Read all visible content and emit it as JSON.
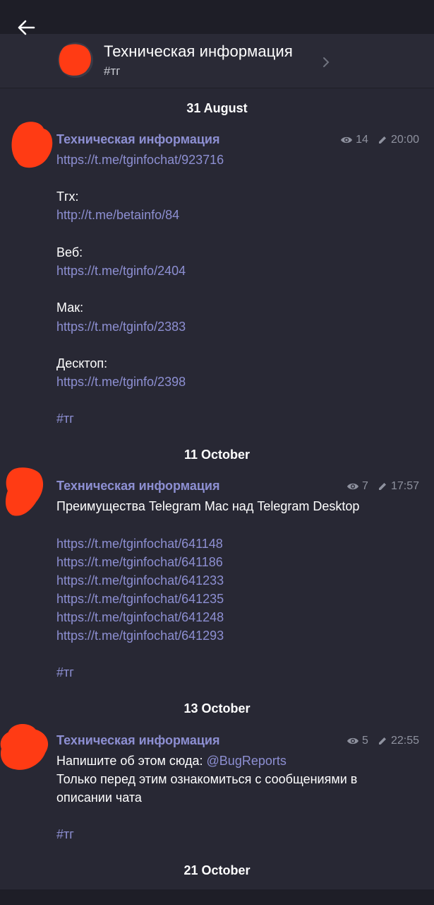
{
  "header": {
    "title": "Техническая информация",
    "subtitle": "#тг"
  },
  "dates": [
    "31 August",
    "11 October",
    "13 October",
    "21 October"
  ],
  "messages": [
    {
      "author": "Техническая информация",
      "views": "14",
      "time": "20:00",
      "lines": [
        {
          "text": "https://t.me/tginfochat/923716",
          "kind": "link"
        },
        {
          "text": "Тгх:",
          "kind": "text"
        },
        {
          "text": "http://t.me/betainfo/84",
          "kind": "link"
        },
        {
          "text": "Веб:",
          "kind": "text"
        },
        {
          "text": "https://t.me/tginfo/2404",
          "kind": "link"
        },
        {
          "text": "Мак:",
          "kind": "text"
        },
        {
          "text": "https://t.me/tginfo/2383",
          "kind": "link"
        },
        {
          "text": "Десктоп:",
          "kind": "text"
        },
        {
          "text": "https://t.me/tginfo/2398",
          "kind": "link"
        },
        {
          "text": "#тг",
          "kind": "hashtag"
        }
      ]
    },
    {
      "author": "Техническая информация",
      "views": "7",
      "time": "17:57",
      "lines": [
        {
          "text": "Преимущества Telegram Mac над Telegram Desktop",
          "kind": "text"
        },
        {
          "text": "https://t.me/tginfochat/641148",
          "kind": "link"
        },
        {
          "text": "https://t.me/tginfochat/641186",
          "kind": "link"
        },
        {
          "text": "https://t.me/tginfochat/641233",
          "kind": "link"
        },
        {
          "text": "https://t.me/tginfochat/641235",
          "kind": "link"
        },
        {
          "text": "https://t.me/tginfochat/641248",
          "kind": "link"
        },
        {
          "text": "https://t.me/tginfochat/641293",
          "kind": "link"
        },
        {
          "text": "#тг",
          "kind": "hashtag"
        }
      ]
    },
    {
      "author": "Техническая информация",
      "views": "5",
      "time": "22:55",
      "lines": [
        {
          "text": "Напишите об этом сюда: ",
          "kind": "text",
          "mention": "@BugReports"
        },
        {
          "text": "Только перед этим ознакомиться с сообщениями в",
          "kind": "text"
        },
        {
          "text": "описании чата",
          "kind": "text"
        },
        {
          "text": "#тг",
          "kind": "hashtag"
        }
      ]
    }
  ],
  "colors": {
    "background": "#282834",
    "header": "#2a2a36",
    "accent": "#8d8fd2",
    "redaction": "#ff3b14"
  },
  "icons": [
    "back-arrow-icon",
    "chevron-right-icon",
    "eye-icon",
    "pencil-icon"
  ]
}
